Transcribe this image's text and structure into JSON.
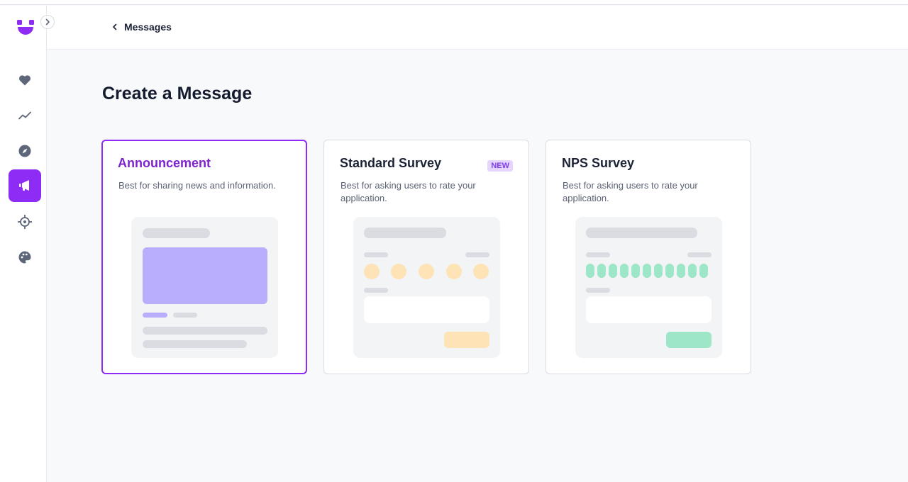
{
  "header": {
    "breadcrumb_label": "Messages"
  },
  "page": {
    "title": "Create a Message"
  },
  "cards": [
    {
      "title": "Announcement",
      "description": "Best for sharing news and information.",
      "selected": true
    },
    {
      "title": "Standard Survey",
      "badge": "NEW",
      "description": "Best for asking users to rate your application."
    },
    {
      "title": "NPS Survey",
      "description": "Best for asking users to rate your application."
    }
  ],
  "sidebar": {
    "items": [
      {
        "icon": "heart-icon"
      },
      {
        "icon": "trend-line-icon"
      },
      {
        "icon": "compass-icon"
      },
      {
        "icon": "megaphone-icon",
        "active": true
      },
      {
        "icon": "target-icon"
      },
      {
        "icon": "palette-icon"
      }
    ]
  },
  "colors": {
    "accent": "#8e2bf5",
    "announcement_title": "#7e22ce",
    "announcement_image": "#b9adfd",
    "survey_rating": "#fde3b5",
    "nps_rating": "#9ee6c8",
    "badge_bg": "#e6d6fd",
    "icon_gray": "#5e6679"
  }
}
